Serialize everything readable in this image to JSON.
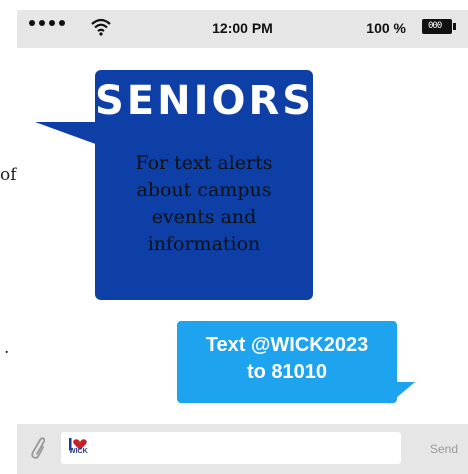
{
  "stray_left": {
    "top_fragment": "of",
    "bottom_fragment": "."
  },
  "statusbar": {
    "time": "12:00 PM",
    "battery_percent": "100 %",
    "battery_label": "000",
    "signal_icon": "signal-dots-icon",
    "wifi_icon": "wifi-icon"
  },
  "bubble_dark": {
    "headline": "SENIORS",
    "lines": [
      "For text alerts",
      "about campus",
      "events and",
      "information"
    ],
    "color": "#0d3fa6"
  },
  "bubble_light": {
    "lines": [
      "Text @WICK2023",
      "to 81010"
    ],
    "color": "#1ea3ee"
  },
  "input_bar": {
    "attach_icon": "paperclip-icon",
    "logo_text": "WICK",
    "send_label": "Send"
  }
}
